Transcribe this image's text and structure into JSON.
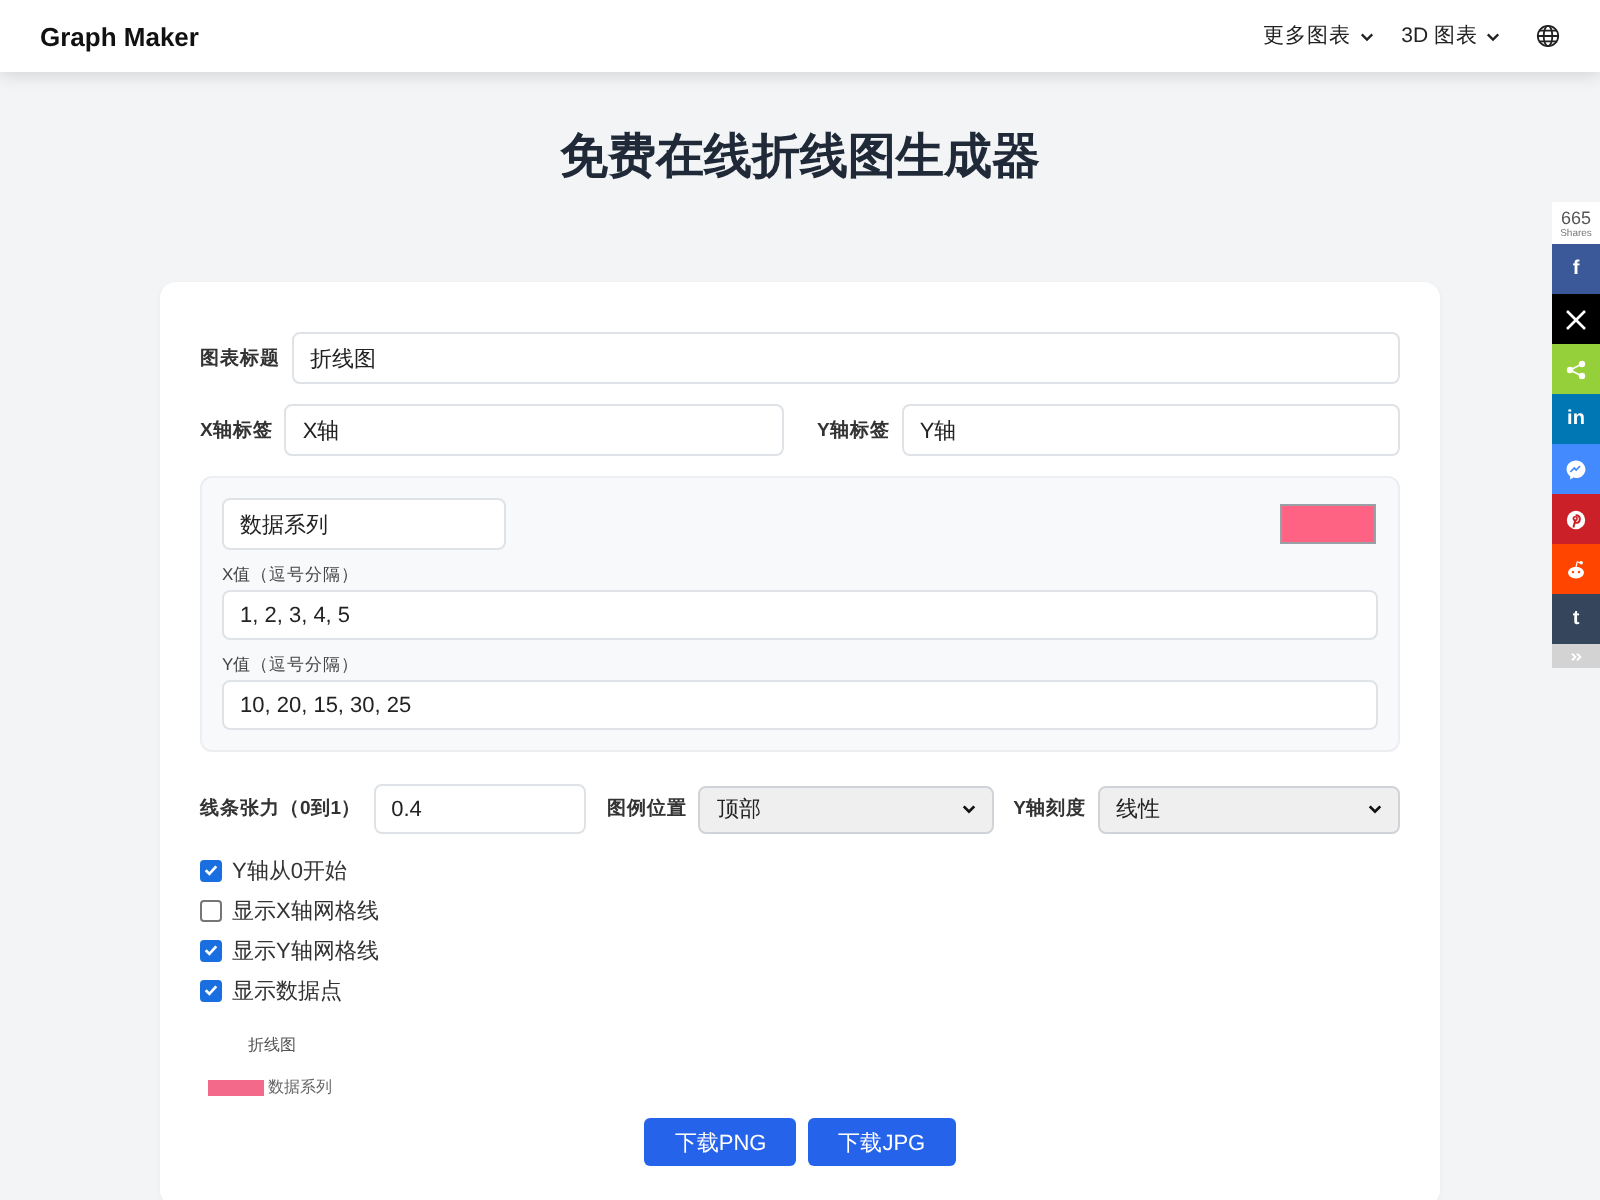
{
  "navbar": {
    "brand": "Graph Maker",
    "menus": [
      {
        "label": "更多图表"
      },
      {
        "label": "3D 图表"
      }
    ]
  },
  "page_title": "免费在线折线图生成器",
  "share_bar": {
    "count": "665",
    "count_label": "Shares",
    "buttons": [
      {
        "kind": "glyph",
        "glyph": "f",
        "color": "#3b5998"
      },
      {
        "kind": "x",
        "color": "#000000"
      },
      {
        "kind": "share",
        "color": "#95d03a"
      },
      {
        "kind": "glyph",
        "glyph": "in",
        "color": "#0077b5"
      },
      {
        "kind": "messenger",
        "color": "#448aff"
      },
      {
        "kind": "pinterest",
        "color": "#cb2027"
      },
      {
        "kind": "reddit",
        "color": "#ff4500"
      },
      {
        "kind": "glyph",
        "glyph": "t",
        "color": "#35465c"
      },
      {
        "kind": "collapse",
        "color": "#d3d3d3"
      }
    ]
  },
  "form": {
    "chart_title": {
      "label": "图表标题",
      "value": "折线图"
    },
    "x_axis_label": {
      "label": "X轴标签",
      "value": "X轴"
    },
    "y_axis_label": {
      "label": "Y轴标签",
      "value": "Y轴"
    },
    "series": [
      {
        "name": "数据系列",
        "color": "#ff6384",
        "x_label": "X值（逗号分隔）",
        "x_values": "1, 2, 3, 4, 5",
        "y_label": "Y值（逗号分隔）",
        "y_values": "10, 20, 15, 30, 25"
      }
    ],
    "tension": {
      "label": "线条张力（0到1）",
      "value": "0.4"
    },
    "legend_position": {
      "label": "图例位置",
      "value": "顶部"
    },
    "y_scale": {
      "label": "Y轴刻度",
      "value": "线性"
    },
    "options": [
      {
        "label": "Y轴从0开始",
        "checked": true
      },
      {
        "label": "显示X轴网格线",
        "checked": false
      },
      {
        "label": "显示Y轴网格线",
        "checked": true
      },
      {
        "label": "显示数据点",
        "checked": true
      }
    ]
  },
  "preview": {
    "title": "折线图",
    "legend": [
      {
        "name": "数据系列",
        "color": "#f2698a"
      }
    ]
  },
  "buttons": [
    "下载PNG",
    "下载JPG"
  ]
}
